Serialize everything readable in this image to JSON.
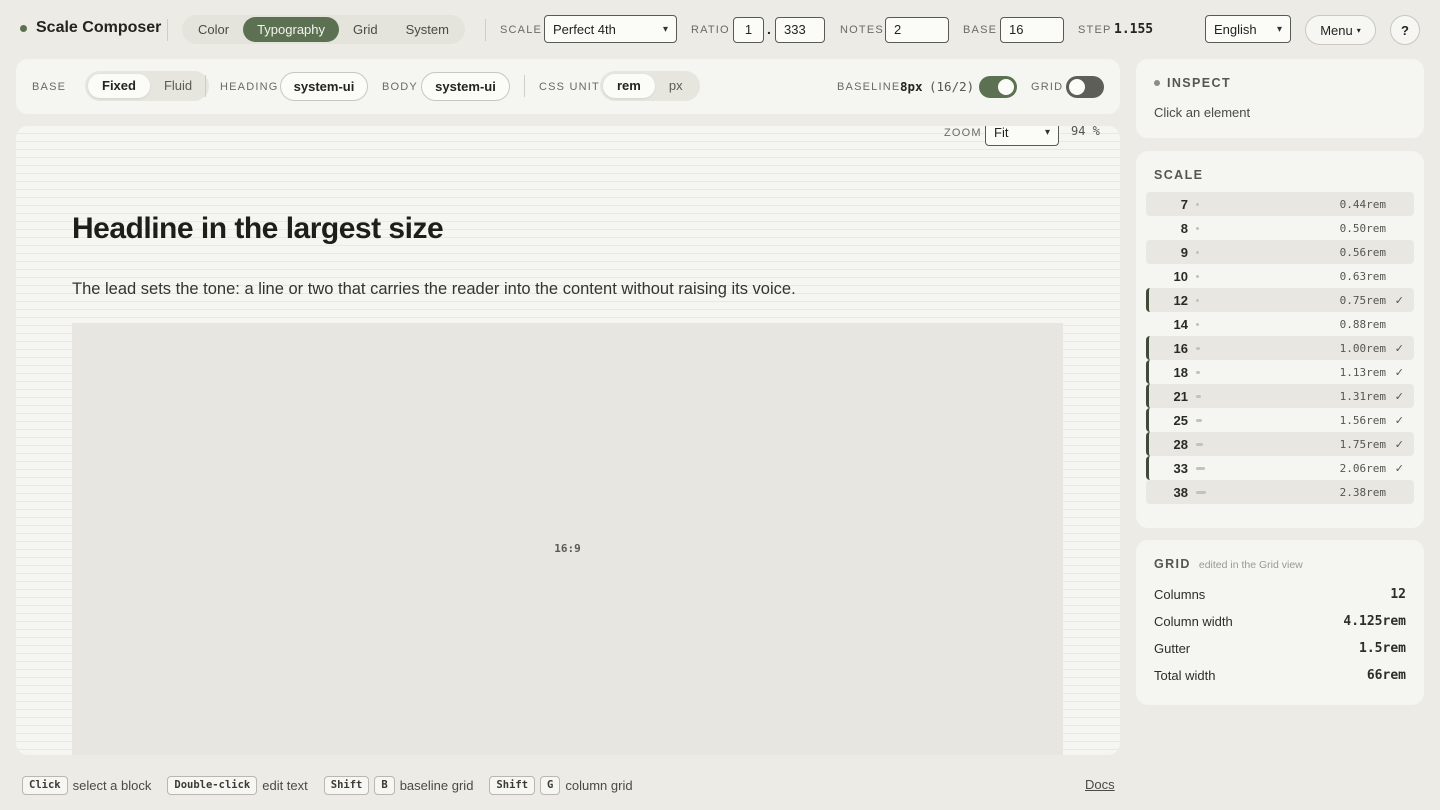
{
  "app": {
    "title": "Scale Composer"
  },
  "views": [
    {
      "label": "Color",
      "active": false
    },
    {
      "label": "Typography",
      "active": true
    },
    {
      "label": "Grid",
      "active": false
    },
    {
      "label": "System",
      "active": false
    }
  ],
  "topbar": {
    "scale_label": "SCALE",
    "scale_value": "Perfect 4th",
    "ratio_label": "RATIO",
    "ratio_int": "1",
    "ratio_sep": ".",
    "ratio_frac": "333",
    "notes_label": "NOTES",
    "notes_value": "2",
    "base_label": "BASE",
    "base_value": "16",
    "step_label": "STEP",
    "step_value": "1.155",
    "language": "English",
    "menu_label": "Menu",
    "help_label": "?"
  },
  "toolbar": {
    "base_label": "BASE",
    "base_options": [
      "Fixed",
      "Fluid"
    ],
    "base_active": "Fixed",
    "heading_label": "HEADING",
    "heading_font": "system-ui",
    "body_label": "BODY",
    "body_font": "system-ui",
    "unit_label": "CSS UNIT",
    "unit_options": [
      "rem",
      "px"
    ],
    "unit_active": "rem",
    "baseline_label": "BASELINE",
    "baseline_value": "8px",
    "baseline_detail": "(16/2)",
    "baseline_on": true,
    "grid_label": "GRID",
    "grid_on": false
  },
  "canvas": {
    "zoom_label": "ZOOM",
    "zoom_value": "Fit",
    "zoom_percent": "94 %",
    "headline": "Headline in the largest size",
    "lead": "The lead sets the tone: a line or two that carries the reader into the content without raising its voice.",
    "media_ratio": "16:9"
  },
  "inspect": {
    "title": "INSPECT",
    "hint": "Click an element"
  },
  "scale": {
    "title": "SCALE",
    "rows": [
      {
        "size": "7",
        "rem": "0.44rem",
        "selected": false
      },
      {
        "size": "8",
        "rem": "0.50rem",
        "selected": false
      },
      {
        "size": "9",
        "rem": "0.56rem",
        "selected": false
      },
      {
        "size": "10",
        "rem": "0.63rem",
        "selected": false
      },
      {
        "size": "12",
        "rem": "0.75rem",
        "selected": true
      },
      {
        "size": "14",
        "rem": "0.88rem",
        "selected": false
      },
      {
        "size": "16",
        "rem": "1.00rem",
        "selected": true
      },
      {
        "size": "18",
        "rem": "1.13rem",
        "selected": true
      },
      {
        "size": "21",
        "rem": "1.31rem",
        "selected": true
      },
      {
        "size": "25",
        "rem": "1.56rem",
        "selected": true
      },
      {
        "size": "28",
        "rem": "1.75rem",
        "selected": true
      },
      {
        "size": "33",
        "rem": "2.06rem",
        "selected": true
      },
      {
        "size": "38",
        "rem": "2.38rem",
        "selected": false
      }
    ],
    "check_glyph": "✓"
  },
  "grid": {
    "title": "GRID",
    "note": "edited in the Grid view",
    "rows": [
      {
        "label": "Columns",
        "value": "12"
      },
      {
        "label": "Column width",
        "value": "4.125rem"
      },
      {
        "label": "Gutter",
        "value": "1.5rem"
      },
      {
        "label": "Total width",
        "value": "66rem"
      }
    ]
  },
  "footer": {
    "hints": [
      {
        "keys": [
          "Click"
        ],
        "text": "select a block"
      },
      {
        "keys": [
          "Double-click"
        ],
        "text": "edit text"
      },
      {
        "keys": [
          "Shift",
          "B"
        ],
        "text": "baseline grid"
      },
      {
        "keys": [
          "Shift",
          "G"
        ],
        "text": "column grid"
      }
    ],
    "docs_label": "Docs"
  },
  "colors": {
    "accent": "#5c7152",
    "background": "#ecebe5",
    "card": "#f5f5f1"
  }
}
